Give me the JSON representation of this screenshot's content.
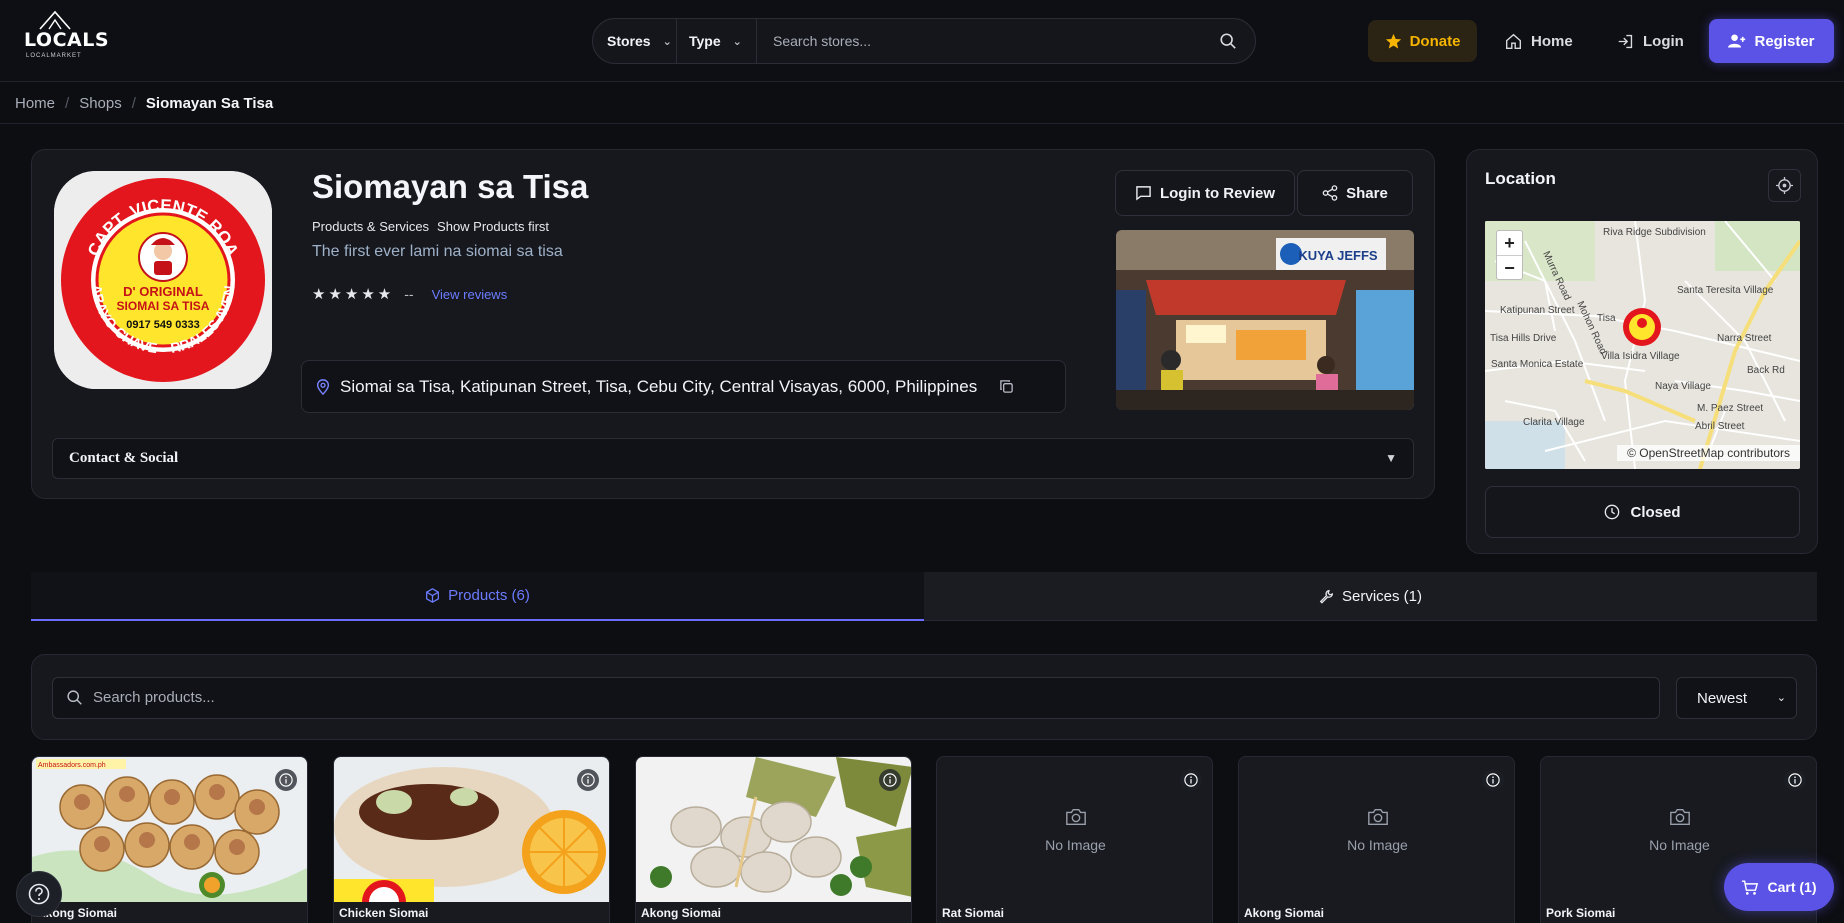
{
  "header": {
    "logo_text": "LOCALS",
    "logo_tagline": "LOCALMARKET",
    "search": {
      "stores_label": "Stores",
      "type_label": "Type",
      "placeholder": "Search stores..."
    },
    "donate_label": "Donate",
    "home_label": "Home",
    "login_label": "Login",
    "register_label": "Register"
  },
  "breadcrumb": [
    "Home",
    "Shops",
    "Siomayan Sa Tisa"
  ],
  "store": {
    "name": "Siomayan sa Tisa",
    "meta": [
      "Products & Services",
      "Show Products first"
    ],
    "description": "The first ever lami na siomai sa tisa",
    "stars": "★★★★★",
    "rating_value": "--",
    "view_reviews": "View reviews",
    "address": "Siomai sa Tisa, Katipunan Street, Tisa, Cebu City, Central Visayas, 6000, Philippines",
    "login_review_label": "Login to Review",
    "share_label": "Share",
    "contact_label": "Contact & Social",
    "logo_text": {
      "top": "CAPT. VICENTE ROA",
      "left": "PABAYO-CHAVEZ",
      "right": "CORRALES AVENUE",
      "brand1": "D' ORIGINAL",
      "brand2": "SIOMAI SA TISA",
      "phone": "0917 549 0333"
    },
    "photo_sign": "KUYA JEFFS"
  },
  "location": {
    "title": "Location",
    "status": "Closed",
    "attribution": "© OpenStreetMap contributors",
    "map_labels": [
      "Riva Ridge Subdivision",
      "Santa Teresita Village",
      "Katipunan Street",
      "Tisa",
      "Tisa Hills Drive",
      "Santa Monica Estate",
      "Villa Isidra Village",
      "Naya Village",
      "Narra Street",
      "Back Rd",
      "M. Paez Street",
      "Clarita Village",
      "Abril Street",
      "Mohon Road",
      "Murra Road"
    ],
    "zoom_in": "+",
    "zoom_out": "−"
  },
  "tabs": {
    "products": "Products (6)",
    "services": "Services (1)"
  },
  "products_search": {
    "placeholder": "Search products...",
    "sort": "Newest"
  },
  "products": [
    {
      "name": "Akong Siomai",
      "image": true,
      "overlay": "Ambassadors.com.ph"
    },
    {
      "name": "Chicken Siomai",
      "image": true
    },
    {
      "name": "Akong Siomai",
      "image": true
    },
    {
      "name": "Rat Siomai",
      "image": false,
      "no_image_label": "No Image"
    },
    {
      "name": "Akong Siomai",
      "image": false,
      "no_image_label": "No Image"
    },
    {
      "name": "Pork Siomai",
      "image": false,
      "no_image_label": "No Image"
    }
  ],
  "cart_label": "Cart (1)",
  "colors": {
    "accent": "#5b52e6",
    "donate": "#f5b400",
    "link": "#6c7cff",
    "background": "#0d0e12"
  }
}
